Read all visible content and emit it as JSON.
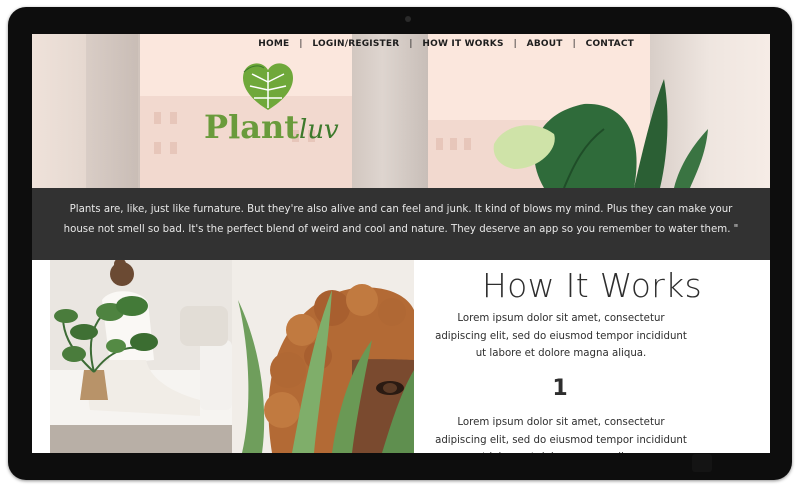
{
  "nav": {
    "items": [
      "HOME",
      "LOGIN/REGISTER",
      "HOW IT WORKS",
      "ABOUT",
      "CONTACT"
    ],
    "separator": "|"
  },
  "logo": {
    "word1": "Plant",
    "word2": "luv",
    "icon": "monstera-heart-leaf-icon",
    "colors": {
      "light_green": "#7cb342",
      "dark_green": "#3d7a2c"
    }
  },
  "banner": {
    "text": "Plants are, like, just like furnature. But they're also alive and can feel and junk. It kind of blows my mind. Plus they can make your house not smell so bad. It's the perfect blend of weird and cool and nature. They deserve an app so you remember to water them. \""
  },
  "how_it_works": {
    "title": "How It Works",
    "paragraph_1": "Lorem ipsum dolor sit amet, consectetur adipiscing elit, sed do eiusmod tempor incididunt ut labore et dolore magna aliqua.",
    "step_number": "1",
    "paragraph_2": "Lorem ipsum dolor sit amet, consectetur adipiscing elit, sed do eiusmod tempor incididunt ut labore et dolore magna aliqua."
  },
  "colors": {
    "hero_bg": "#fbe7dd",
    "banner_bg": "#323232",
    "bezel": "#0d0d0d",
    "text_dark": "#2e2e2e"
  }
}
